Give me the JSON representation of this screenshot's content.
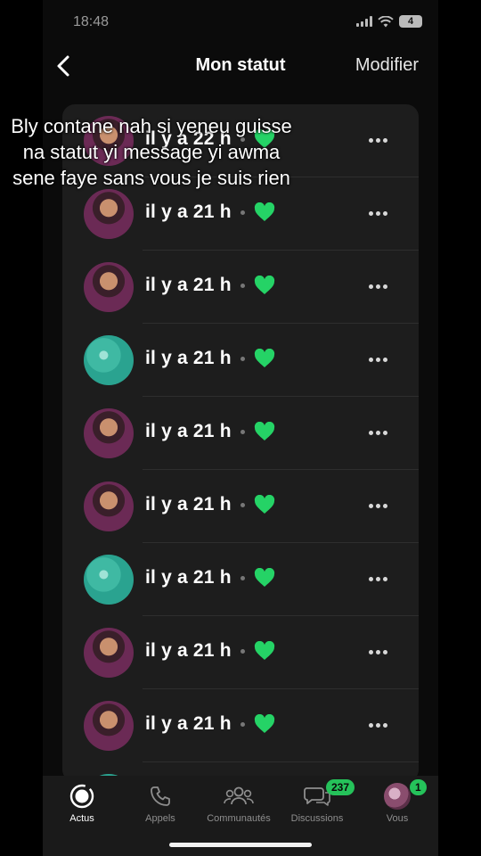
{
  "status_bar": {
    "time": "18:48",
    "battery": "4"
  },
  "nav": {
    "title": "Mon statut",
    "edit_label": "Modifier"
  },
  "caption": "Bly contane nah si yeneu guisse na statut yi message yi awma sene faye sans vous je suis rien",
  "status_items": [
    {
      "time": "il y a 22 h",
      "avatar": "photo"
    },
    {
      "time": "il y a 21 h",
      "avatar": "photo"
    },
    {
      "time": "il y a 21 h",
      "avatar": "photo"
    },
    {
      "time": "il y a 21 h",
      "avatar": "fabric"
    },
    {
      "time": "il y a 21 h",
      "avatar": "photo"
    },
    {
      "time": "il y a 21 h",
      "avatar": "photo"
    },
    {
      "time": "il y a 21 h",
      "avatar": "fabric"
    },
    {
      "time": "il y a 21 h",
      "avatar": "photo"
    },
    {
      "time": "il y a 21 h",
      "avatar": "photo"
    }
  ],
  "tabs": [
    {
      "label": "Actus",
      "icon": "status-icon",
      "active": true
    },
    {
      "label": "Appels",
      "icon": "phone-icon"
    },
    {
      "label": "Communautés",
      "icon": "community-icon"
    },
    {
      "label": "Discussions",
      "icon": "chat-icon",
      "badge": "237"
    },
    {
      "label": "Vous",
      "icon": "profile-avatar",
      "badge": "1"
    }
  ],
  "colors": {
    "accent": "#25c25a",
    "heart": "#25d366",
    "list_bg": "#1d1d1d"
  }
}
